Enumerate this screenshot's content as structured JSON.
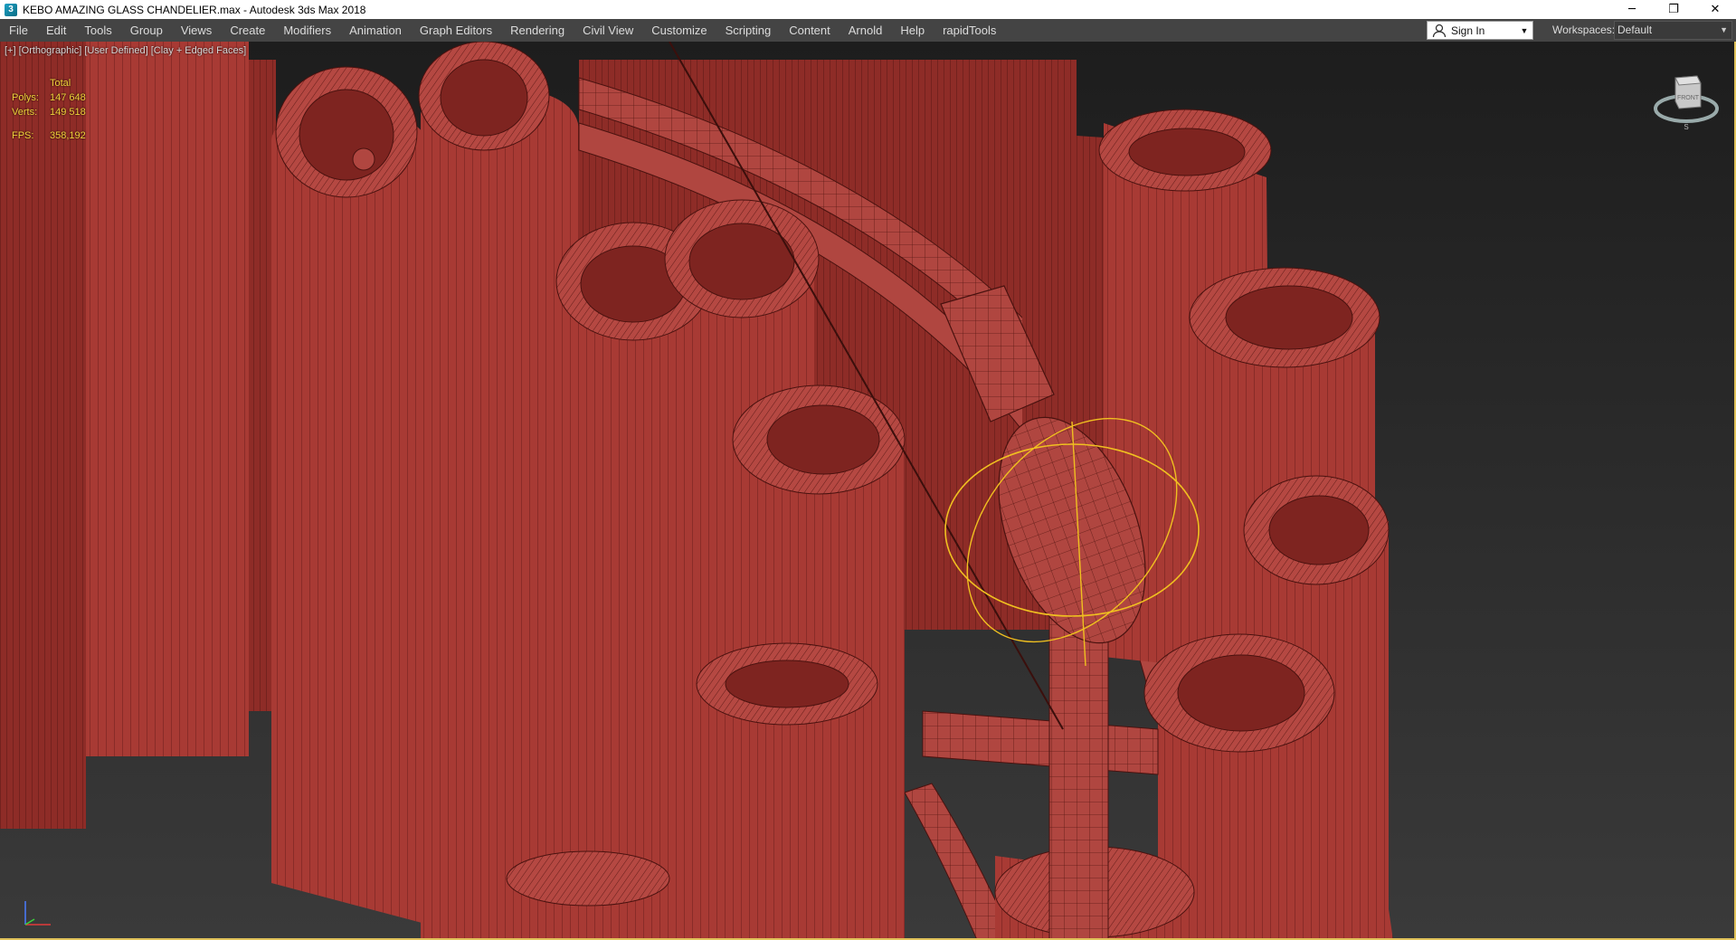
{
  "window": {
    "title": "KEBO AMAZING GLASS CHANDELIER.max - Autodesk 3ds Max 2018",
    "icon_glyph": "3",
    "minimize_glyph": "─",
    "restore_glyph": "❐",
    "close_glyph": "✕"
  },
  "menu": {
    "items": [
      "File",
      "Edit",
      "Tools",
      "Group",
      "Views",
      "Create",
      "Modifiers",
      "Animation",
      "Graph Editors",
      "Rendering",
      "Civil View",
      "Customize",
      "Scripting",
      "Content",
      "Arnold",
      "Help",
      "rapidTools"
    ]
  },
  "account": {
    "signin_label": "Sign In",
    "user_icon": "user-icon",
    "caret": "▼"
  },
  "workspaces": {
    "label": "Workspaces:",
    "value": "Default",
    "caret": "▼"
  },
  "viewport": {
    "label": "[+] [Orthographic] [User Defined] [Clay + Edged Faces]",
    "stats": {
      "header": "Total",
      "polys_label": "Polys:",
      "polys_value": "147 648",
      "verts_label": "Verts:",
      "verts_value": "149 518",
      "fps_label": "FPS:",
      "fps_value": "358,192"
    },
    "viewcube_face": "FRONT",
    "viewcube_south": "S",
    "colors": {
      "clay": "#a83a34",
      "clay_dark": "#7e2420",
      "clay_light": "#c0524a",
      "edge": "#3b0f0c",
      "selection": "#f0c020",
      "stats_text": "#f0d23a"
    }
  }
}
